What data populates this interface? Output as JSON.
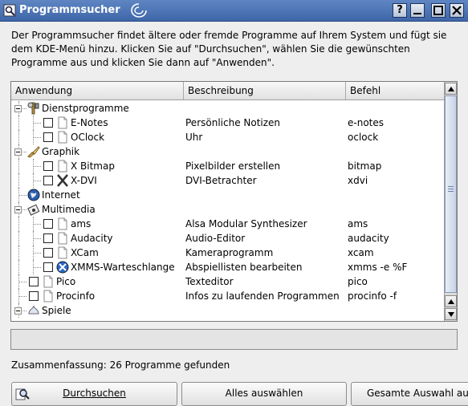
{
  "window": {
    "title": "Programmsucher",
    "controls": [
      "help",
      "close",
      "maximize",
      "minimize"
    ]
  },
  "intro_text": "Der Programmsucher findet ältere oder fremde Programme auf Ihrem System und fügt sie dem KDE-Menü hinzu. Klicken Sie auf \"Durchsuchen\", wählen Sie die gewünschten Programme aus und klicken Sie dann auf \"Anwenden\".",
  "columns": [
    "Anwendung",
    "Beschreibung",
    "Befehl"
  ],
  "rows": [
    {
      "level": 0,
      "type": "group",
      "name": "Dienstprogramme",
      "desc": "",
      "cmd": "",
      "icon": "tools-icon"
    },
    {
      "level": 1,
      "type": "item",
      "name": "E-Notes",
      "desc": "Persönliche Notizen",
      "cmd": "e-notes",
      "icon": "document-icon"
    },
    {
      "level": 1,
      "type": "item",
      "name": "OClock",
      "desc": "Uhr",
      "cmd": "oclock",
      "icon": "document-icon"
    },
    {
      "level": 0,
      "type": "group",
      "name": "Graphik",
      "desc": "",
      "cmd": "",
      "icon": "paint-icon"
    },
    {
      "level": 1,
      "type": "item",
      "name": "X Bitmap",
      "desc": "Pixelbilder erstellen",
      "cmd": "bitmap",
      "icon": "document-icon"
    },
    {
      "level": 1,
      "type": "item",
      "name": "X-DVI",
      "desc": "DVI-Betrachter",
      "cmd": "xdvi",
      "icon": "x-logo-icon"
    },
    {
      "level": 0,
      "type": "group-leaf",
      "name": "Internet",
      "desc": "",
      "cmd": "",
      "icon": "globe-icon"
    },
    {
      "level": 0,
      "type": "group",
      "name": "Multimedia",
      "desc": "",
      "cmd": "",
      "icon": "multimedia-icon"
    },
    {
      "level": 1,
      "type": "item",
      "name": "ams",
      "desc": "Alsa Modular Synthesizer",
      "cmd": "ams",
      "icon": "document-icon"
    },
    {
      "level": 1,
      "type": "item",
      "name": "Audacity",
      "desc": "Audio-Editor",
      "cmd": "audacity",
      "icon": "document-icon"
    },
    {
      "level": 1,
      "type": "item",
      "name": "XCam",
      "desc": "Kameraprogramm",
      "cmd": "xcam",
      "icon": "document-icon"
    },
    {
      "level": 1,
      "type": "item",
      "name": "XMMS-Warteschlange",
      "desc": "Abspiellisten bearbeiten",
      "cmd": "xmms -e %F",
      "icon": "xmms-icon"
    },
    {
      "level": 0,
      "type": "item",
      "name": "Pico",
      "desc": "Texteditor",
      "cmd": "pico",
      "icon": "document-icon"
    },
    {
      "level": 0,
      "type": "item",
      "name": "Procinfo",
      "desc": "Infos zu laufenden Programmen",
      "cmd": "procinfo -f",
      "icon": "document-icon"
    },
    {
      "level": 0,
      "type": "group",
      "name": "Spiele",
      "desc": "",
      "cmd": "",
      "icon": "games-icon"
    }
  ],
  "summary": "Zusammenfassung: 26 Programme gefunden",
  "buttons": {
    "scan": "Durchsuchen",
    "select_all": "Alles auswählen",
    "deselect_all": "Gesamte Auswahl au"
  }
}
